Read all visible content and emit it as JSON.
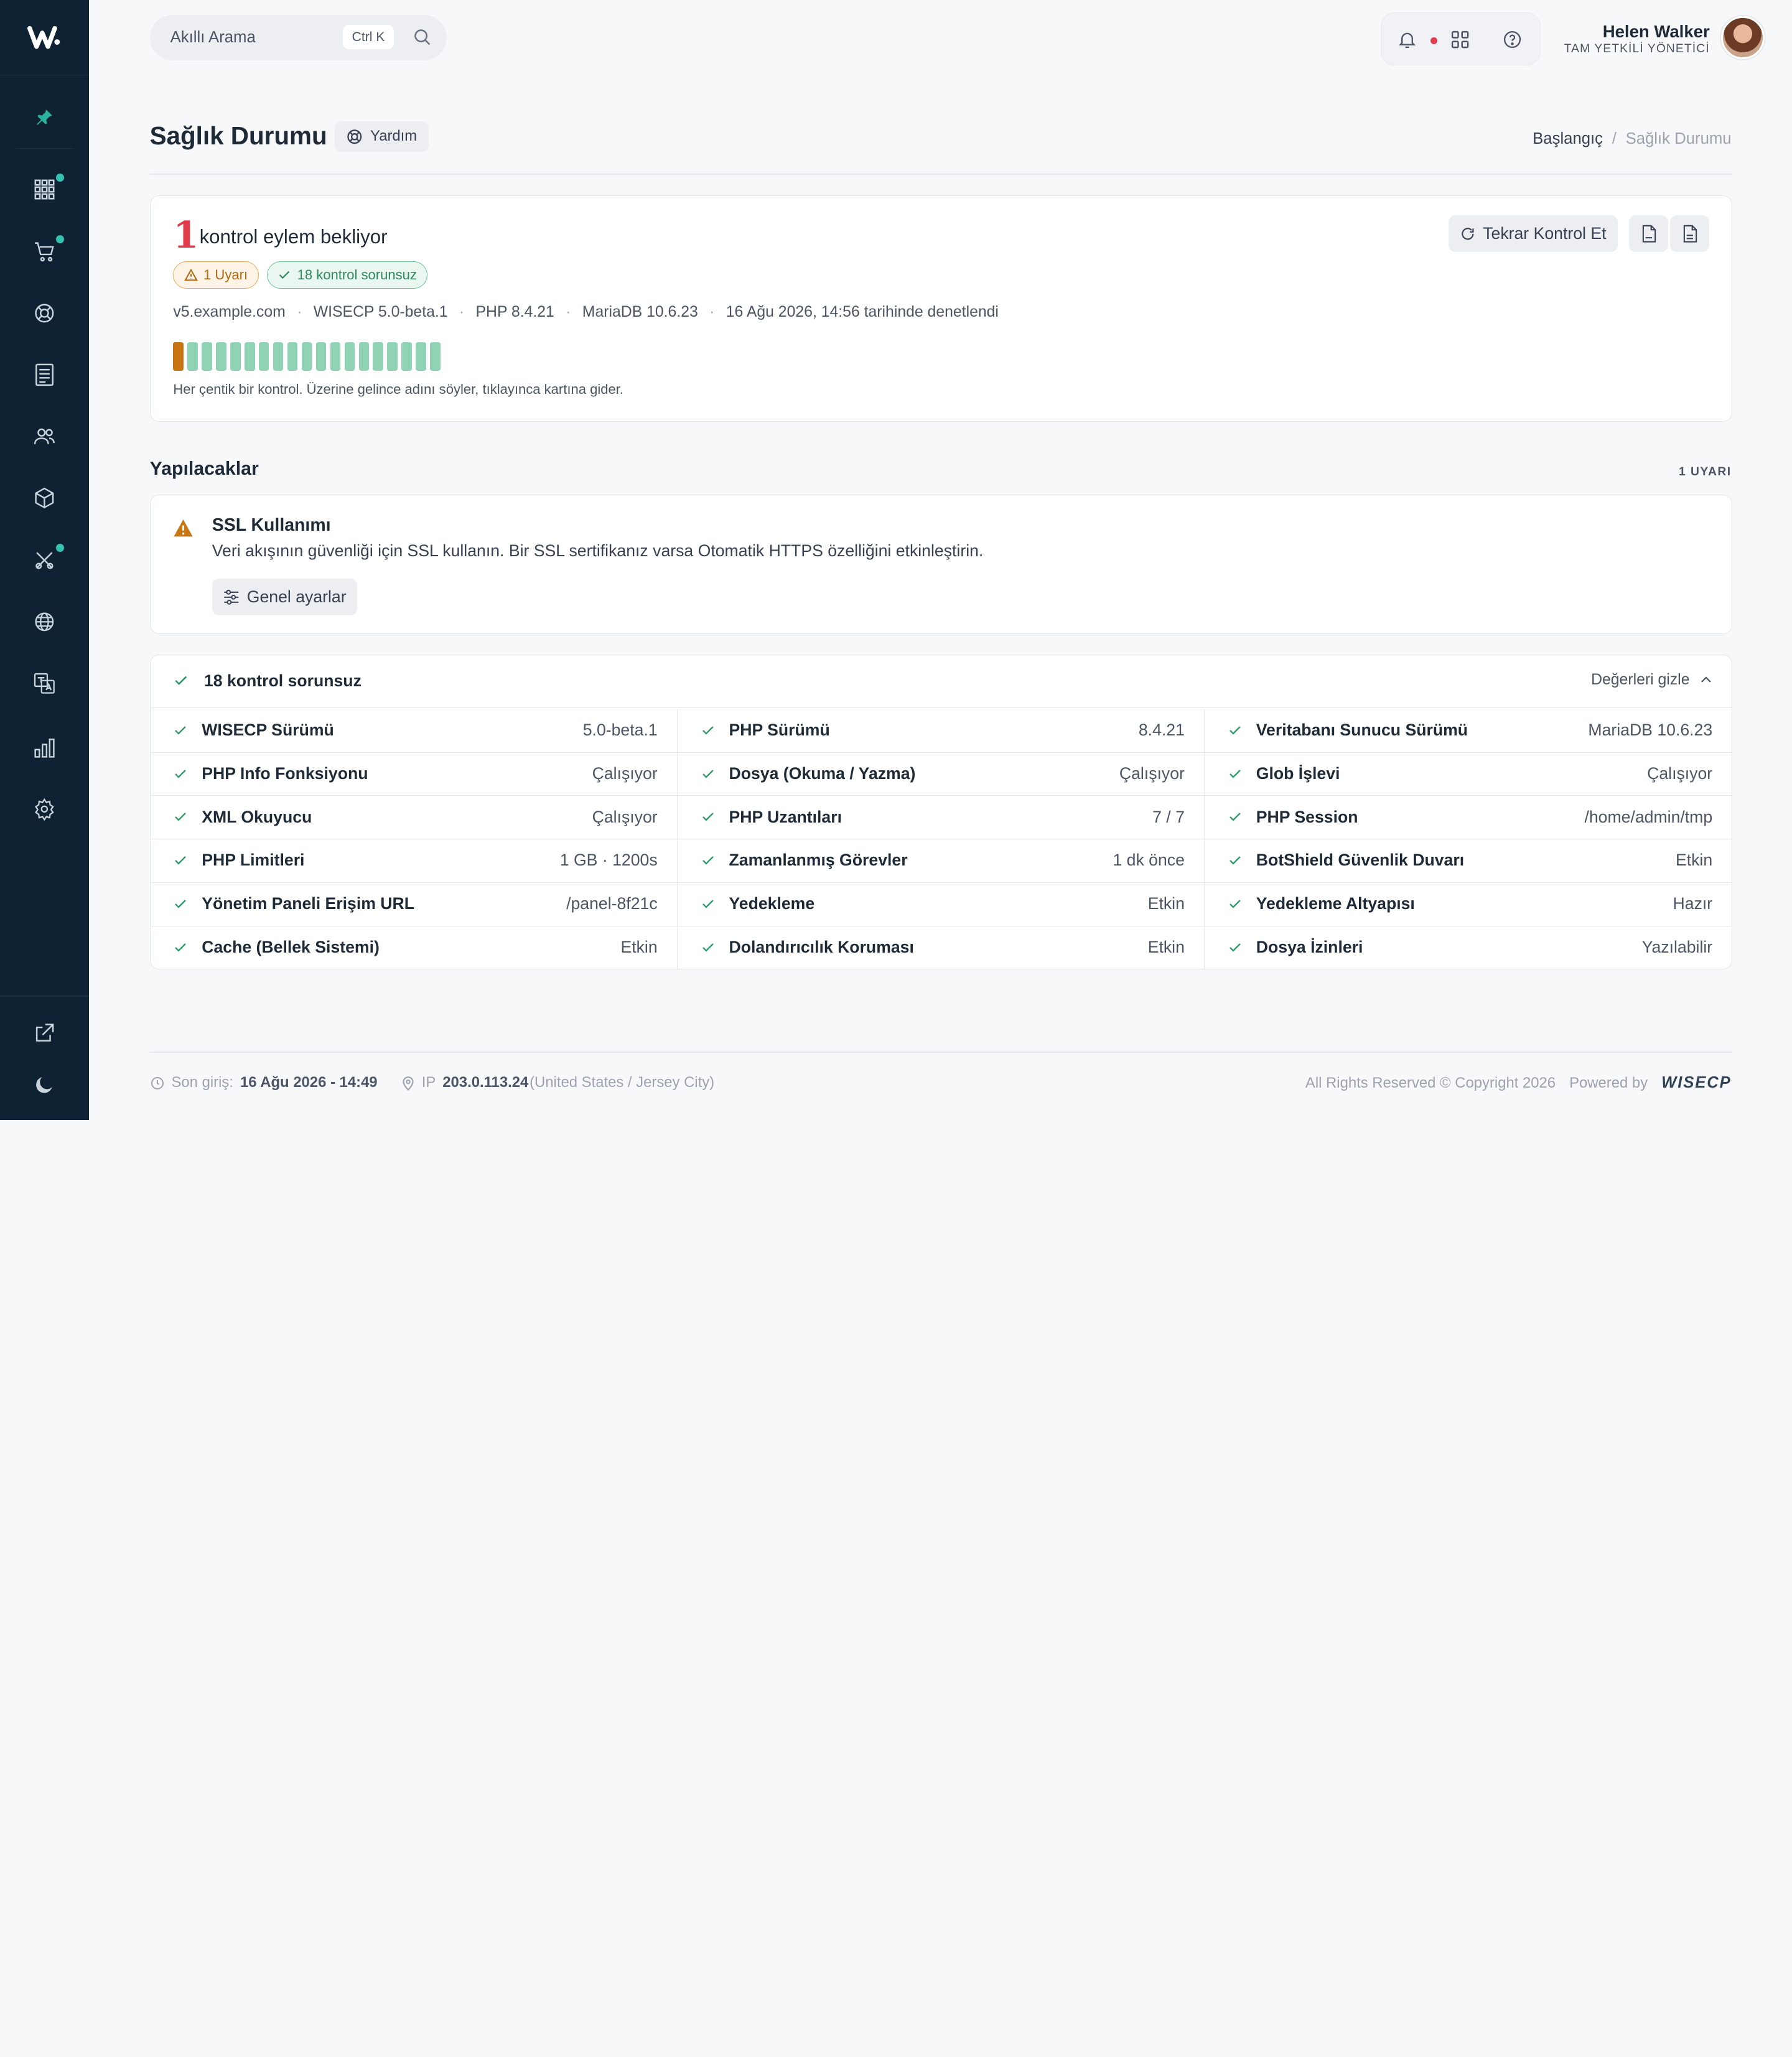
{
  "header": {
    "search_placeholder": "Akıllı Arama",
    "search_shortcut": "Ctrl K",
    "user_name": "Helen Walker",
    "user_role": "TAM YETKİLİ YÖNETİCİ"
  },
  "page": {
    "title": "Sağlık Durumu",
    "help_label": "Yardım",
    "breadcrumb_home": "Başlangıç",
    "breadcrumb_sep": "/",
    "breadcrumb_current": "Sağlık Durumu"
  },
  "summary": {
    "pending_count": "1",
    "pending_text": "kontrol eylem bekliyor",
    "warning_badge": "1 Uyarı",
    "ok_badge": "18 kontrol sorunsuz",
    "meta": {
      "domain": "v5.example.com",
      "version": "WISECP 5.0-beta.1",
      "php": "PHP 8.4.21",
      "db": "MariaDB 10.6.23",
      "checked_at": "16 Ağu 2026, 14:56 tarihinde denetlendi",
      "dot": "·"
    },
    "hint": "Her çentik bir kontrol. Üzerine gelince adını söyler, tıklayınca kartına gider.",
    "recheck_label": "Tekrar Kontrol Et",
    "tick_states": [
      "warning",
      "ok",
      "ok",
      "ok",
      "ok",
      "ok",
      "ok",
      "ok",
      "ok",
      "ok",
      "ok",
      "ok",
      "ok",
      "ok",
      "ok",
      "ok",
      "ok",
      "ok",
      "ok"
    ]
  },
  "todo": {
    "title": "Yapılacaklar",
    "count": "1 UYARI",
    "item_title": "SSL Kullanımı",
    "item_desc": "Veri akışının güvenliği için SSL kullanın. Bir SSL sertifikanız varsa Otomatik HTTPS özelliğini etkinleştirin.",
    "item_button": "Genel ayarlar"
  },
  "checks": {
    "title": "18 kontrol sorunsuz",
    "toggle_label": "Değerleri gizle",
    "rows": [
      [
        {
          "name": "WISECP Sürümü",
          "value": "5.0-beta.1"
        },
        {
          "name": "PHP Sürümü",
          "value": "8.4.21"
        },
        {
          "name": "Veritabanı Sunucu Sürümü",
          "value": "MariaDB 10.6.23"
        }
      ],
      [
        {
          "name": "PHP Info Fonksiyonu",
          "value": "Çalışıyor"
        },
        {
          "name": "Dosya (Okuma / Yazma)",
          "value": "Çalışıyor"
        },
        {
          "name": "Glob İşlevi",
          "value": "Çalışıyor"
        }
      ],
      [
        {
          "name": "XML Okuyucu",
          "value": "Çalışıyor"
        },
        {
          "name": "PHP Uzantıları",
          "value": "7 / 7"
        },
        {
          "name": "PHP Session",
          "value": "/home/admin/tmp"
        }
      ],
      [
        {
          "name": "PHP Limitleri",
          "value": "1 GB · 1200s"
        },
        {
          "name": "Zamanlanmış Görevler",
          "value": "1 dk önce"
        },
        {
          "name": "BotShield Güvenlik Duvarı",
          "value": "Etkin"
        }
      ],
      [
        {
          "name": "Yönetim Paneli Erişim URL",
          "value": "/panel-8f21c"
        },
        {
          "name": "Yedekleme",
          "value": "Etkin"
        },
        {
          "name": "Yedekleme Altyapısı",
          "value": "Hazır"
        }
      ],
      [
        {
          "name": "Cache (Bellek Sistemi)",
          "value": "Etkin"
        },
        {
          "name": "Dolandırıcılık Koruması",
          "value": "Etkin"
        },
        {
          "name": "Dosya İzinleri",
          "value": "Yazılabilir"
        }
      ]
    ]
  },
  "footer": {
    "last_login_label": "Son giriş:",
    "last_login_value": "16 Ağu 2026 - 14:49",
    "ip_label": "IP",
    "ip_value": "203.0.113.24",
    "ip_location": "(United States / Jersey City)",
    "copyright": "All Rights Reserved © Copyright 2026",
    "powered_by": "Powered by",
    "brand": "WISECP"
  },
  "colors": {
    "sidebar_bg": "#0e2233",
    "accent_teal": "#35c2b0",
    "danger": "#e23b4a",
    "warning": "#c87613",
    "success": "#2e9a68"
  },
  "icons": {
    "sidebar": [
      "pin-icon",
      "apps-grid-icon",
      "cart-icon",
      "lifebuoy-icon",
      "invoice-icon",
      "users-icon",
      "box-icon",
      "tools-icon",
      "globe-icon",
      "translate-icon",
      "stats-icon",
      "gear-icon"
    ],
    "sidebar_bottom": [
      "external-link-icon",
      "moon-icon"
    ]
  }
}
